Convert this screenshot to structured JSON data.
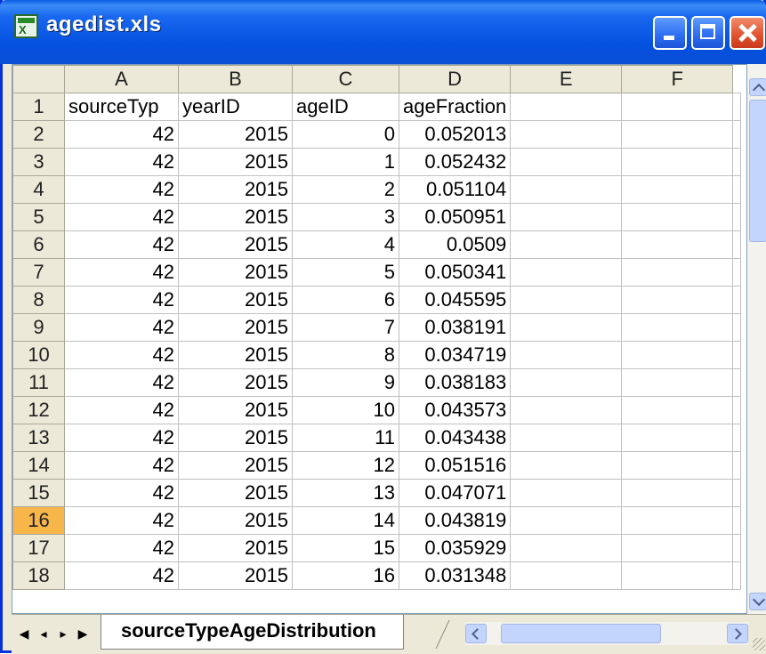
{
  "window": {
    "title": "agedist.xls",
    "colors": {
      "titlebar": "#0a5ce6",
      "close": "#e0502d",
      "active_row_header": "#f7b64a"
    }
  },
  "columns": [
    "A",
    "B",
    "C",
    "D",
    "E",
    "F"
  ],
  "rows": [
    {
      "n": "1",
      "cells": [
        "sourceTyp",
        "yearID",
        "ageID",
        "ageFraction",
        "",
        ""
      ]
    },
    {
      "n": "2",
      "cells": [
        "42",
        "2015",
        "0",
        "0.052013",
        "",
        ""
      ]
    },
    {
      "n": "3",
      "cells": [
        "42",
        "2015",
        "1",
        "0.052432",
        "",
        ""
      ]
    },
    {
      "n": "4",
      "cells": [
        "42",
        "2015",
        "2",
        "0.051104",
        "",
        ""
      ]
    },
    {
      "n": "5",
      "cells": [
        "42",
        "2015",
        "3",
        "0.050951",
        "",
        ""
      ]
    },
    {
      "n": "6",
      "cells": [
        "42",
        "2015",
        "4",
        "0.0509",
        "",
        ""
      ]
    },
    {
      "n": "7",
      "cells": [
        "42",
        "2015",
        "5",
        "0.050341",
        "",
        ""
      ]
    },
    {
      "n": "8",
      "cells": [
        "42",
        "2015",
        "6",
        "0.045595",
        "",
        ""
      ]
    },
    {
      "n": "9",
      "cells": [
        "42",
        "2015",
        "7",
        "0.038191",
        "",
        ""
      ]
    },
    {
      "n": "10",
      "cells": [
        "42",
        "2015",
        "8",
        "0.034719",
        "",
        ""
      ]
    },
    {
      "n": "11",
      "cells": [
        "42",
        "2015",
        "9",
        "0.038183",
        "",
        ""
      ]
    },
    {
      "n": "12",
      "cells": [
        "42",
        "2015",
        "10",
        "0.043573",
        "",
        ""
      ]
    },
    {
      "n": "13",
      "cells": [
        "42",
        "2015",
        "11",
        "0.043438",
        "",
        ""
      ]
    },
    {
      "n": "14",
      "cells": [
        "42",
        "2015",
        "12",
        "0.051516",
        "",
        ""
      ]
    },
    {
      "n": "15",
      "cells": [
        "42",
        "2015",
        "13",
        "0.047071",
        "",
        ""
      ]
    },
    {
      "n": "16",
      "cells": [
        "42",
        "2015",
        "14",
        "0.043819",
        "",
        ""
      ],
      "active": true
    },
    {
      "n": "17",
      "cells": [
        "42",
        "2015",
        "15",
        "0.035929",
        "",
        ""
      ]
    },
    {
      "n": "18",
      "cells": [
        "42",
        "2015",
        "16",
        "0.031348",
        "",
        ""
      ]
    }
  ],
  "sheet_tab": {
    "label": "sourceTypeAgeDistribution"
  },
  "nav": {
    "first": "◀",
    "prev": "◂",
    "next": "▸",
    "last": "▶"
  },
  "icons": [
    "excel-app-icon",
    "minimize-icon",
    "maximize-icon",
    "close-icon",
    "scroll-up-icon",
    "scroll-down-icon",
    "scroll-left-icon",
    "scroll-right-icon",
    "resize-grip-icon"
  ]
}
